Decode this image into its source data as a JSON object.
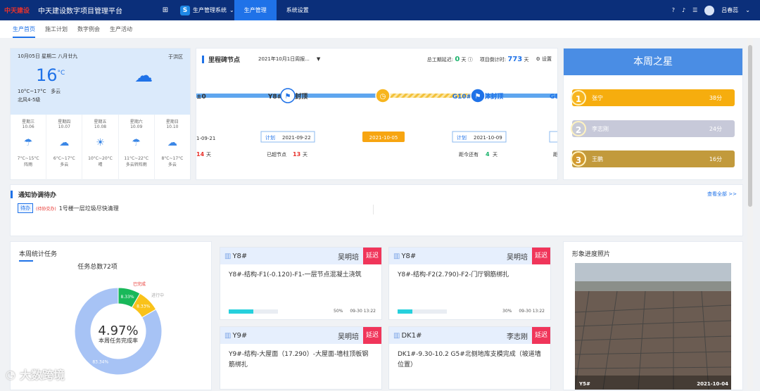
{
  "topbar": {
    "company": "中天建设",
    "platform_title": "中天建设数字项目管理平台",
    "system_label": "生产管理系统",
    "nav": [
      "生产管理",
      "系统设置"
    ],
    "user_name": "吕春蕊"
  },
  "tabs": [
    "生产首页",
    "施工计划",
    "数字例会",
    "生产活动"
  ],
  "weather": {
    "date": "10月05日 星期二 八月廿九",
    "location": "于洪区",
    "temp": "16",
    "unit": "°C",
    "range": "10°C~17°C",
    "condition": "多云",
    "wind": "北风4-5级",
    "icon": "cloud-sun-icon",
    "days": [
      {
        "weekday": "星期三",
        "date": "10.06",
        "temp": "7°C~15°C",
        "desc": "阵雨",
        "icon": "rain-icon"
      },
      {
        "weekday": "星期四",
        "date": "10.07",
        "temp": "6°C~17°C",
        "desc": "多云",
        "icon": "cloud-sun-icon"
      },
      {
        "weekday": "星期五",
        "date": "10.08",
        "temp": "10°C~20°C",
        "desc": "晴",
        "icon": "sun-icon"
      },
      {
        "weekday": "星期六",
        "date": "10.09",
        "temp": "11°C~22°C",
        "desc": "多云转阵雨",
        "icon": "rain-icon"
      },
      {
        "weekday": "星期日",
        "date": "10.10",
        "temp": "8°C~17°C",
        "desc": "多云",
        "icon": "cloud-sun-icon"
      }
    ]
  },
  "milestone": {
    "title": "里程碑节点",
    "week": "2021年10月1日周报...",
    "total_label": "总工期延迟:",
    "total_value": "0",
    "total_unit": "天",
    "countdown_label": "项目倒计时:",
    "countdown_value": "773",
    "countdown_unit": "天",
    "settings": "设置",
    "nodes": [
      {
        "name": "±0",
        "plan_label": "",
        "date": "1-09-21",
        "note_prefix": "",
        "note_value": "14",
        "note_suffix": "天"
      },
      {
        "name": "Y8#主体封顶",
        "plan_label": "计划",
        "date": "2021-09-22",
        "note_prefix": "已超节点",
        "note_value": "13",
        "note_suffix": "天"
      },
      {
        "name": "今日",
        "plan_label": "",
        "date": "2021-10-05",
        "note_prefix": "",
        "note_value": "",
        "note_suffix": ""
      },
      {
        "name": "G10#楼主体封顶",
        "plan_label": "计划",
        "date": "2021-10-09",
        "note_prefix": "距今还有",
        "note_value": "4",
        "note_suffix": "天"
      },
      {
        "name": "G8",
        "plan_label": "",
        "date": "",
        "note_prefix": "距",
        "note_value": "",
        "note_suffix": ""
      }
    ]
  },
  "star": {
    "title": "本周之星",
    "ranks": [
      {
        "rank": "1",
        "name": "张宁",
        "score": "38分",
        "color": "#f6ad0e"
      },
      {
        "rank": "2",
        "name": "李志刚",
        "score": "24分",
        "color": "#c7c9d9"
      },
      {
        "rank": "3",
        "name": "王鹏",
        "score": "16分",
        "color": "#c29a3c"
      }
    ]
  },
  "notice": {
    "title": "通知协调待办",
    "more": "查看全部 >>",
    "tag": "待办",
    "pending": "(待协交办)",
    "text": "1号楼一层垃圾尽快清理"
  },
  "tasks": {
    "title": "本周统计任务",
    "total": "任务总数72项",
    "center_value": "4.97%",
    "center_label": "本周任务完成率",
    "chart_data": {
      "type": "pie",
      "categories": [
        "已完成",
        "进行中",
        ""
      ],
      "values": [
        8.33,
        8.33,
        83.34
      ],
      "colors": [
        "#19b85a",
        "#f9c21a",
        "#a7c3f5"
      ],
      "labels": [
        "8.33%",
        "8.33%",
        "83.34%"
      ]
    }
  },
  "workcards": [
    {
      "building": "Y8#",
      "owner": "吴明培",
      "delay": "延迟",
      "text": "Y8#-结构-F1(-0.120)-F1-一层节点混凝土浇筑",
      "progress": 0.5,
      "pct": "50%",
      "time": "09-30 13:22"
    },
    {
      "building": "Y8#",
      "owner": "吴明培",
      "delay": "延迟",
      "text": "Y8#-结构-F2(2.790)-F2-门厅钢筋绑扎",
      "progress": 0.3,
      "pct": "30%",
      "time": "09-30 13:22"
    },
    {
      "building": "Y9#",
      "owner": "吴明培",
      "delay": "延迟",
      "text": "Y9#-结构-大屋面（17.290）-大屋面-墙柱顶板钢筋绑扎",
      "progress": 0,
      "pct": "",
      "time": ""
    },
    {
      "building": "DK1#",
      "owner": "李志刚",
      "delay": "延迟",
      "text": "DK1#-9.30-10.2 G5#北侧地库支模完成（坡道墙位置）",
      "progress": 0,
      "pct": "",
      "time": ""
    }
  ],
  "photo": {
    "title": "形象进度照片",
    "tag": "Y5#",
    "date": "2021-10-04"
  },
  "watermark": "大数跨境"
}
